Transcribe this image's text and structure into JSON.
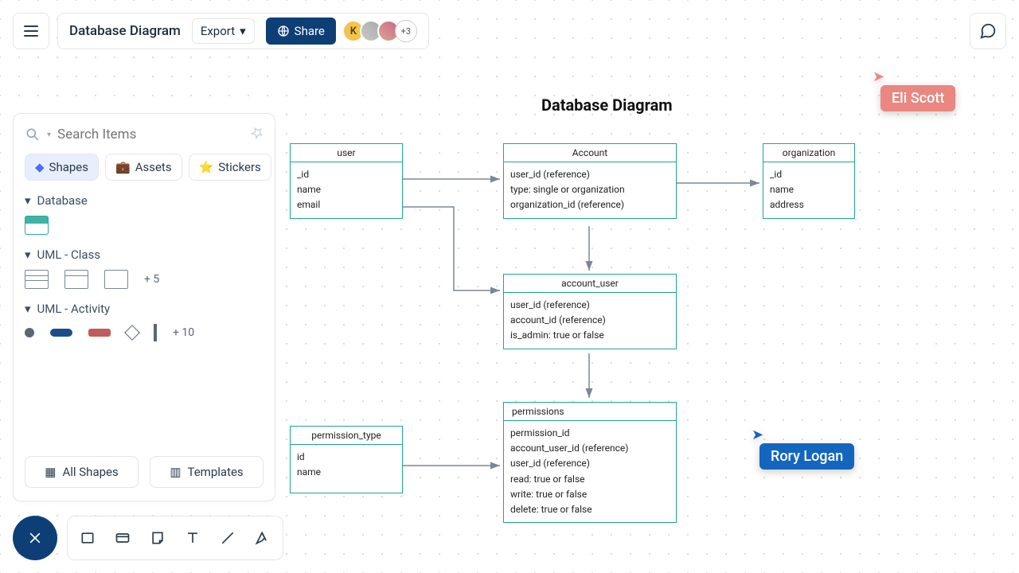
{
  "header": {
    "doc_title": "Database Diagram",
    "export": "Export",
    "share": "Share",
    "avatar1_letter": "K",
    "plus_count": "+3"
  },
  "panel": {
    "search_placeholder": "Search Items",
    "tabs": {
      "shapes": "Shapes",
      "assets": "Assets",
      "stickers": "Stickers"
    },
    "cat_database": "Database",
    "cat_uml_class": "UML - Class",
    "uml_more": "+ 5",
    "cat_uml_activity": "UML - Activity",
    "activity_more": "+ 10",
    "all_shapes": "All Shapes",
    "templates": "Templates"
  },
  "diagram": {
    "title": "Database Diagram",
    "entities": {
      "user": {
        "name": "user",
        "fields": [
          "_id",
          "name",
          "email"
        ]
      },
      "account": {
        "name": "Account",
        "fields": [
          "user_id (reference)",
          "type: single or organization",
          "organization_id (reference)"
        ]
      },
      "org": {
        "name": "organization",
        "fields": [
          "_id",
          "name",
          "address"
        ]
      },
      "account_user": {
        "name": "account_user",
        "fields": [
          "user_id (reference)",
          "account_id (reference)",
          "is_admin: true or false"
        ]
      },
      "permissions": {
        "name": "permissions",
        "fields": [
          "permission_id",
          "account_user_id (reference)",
          "user_id (reference)",
          "read: true or false",
          "write: true or false",
          "delete: true or false"
        ]
      },
      "permission_type": {
        "name": "permission_type",
        "fields": [
          "id",
          "name"
        ]
      }
    }
  },
  "users": {
    "eli": "Eli Scott",
    "rory": "Rory Logan"
  }
}
